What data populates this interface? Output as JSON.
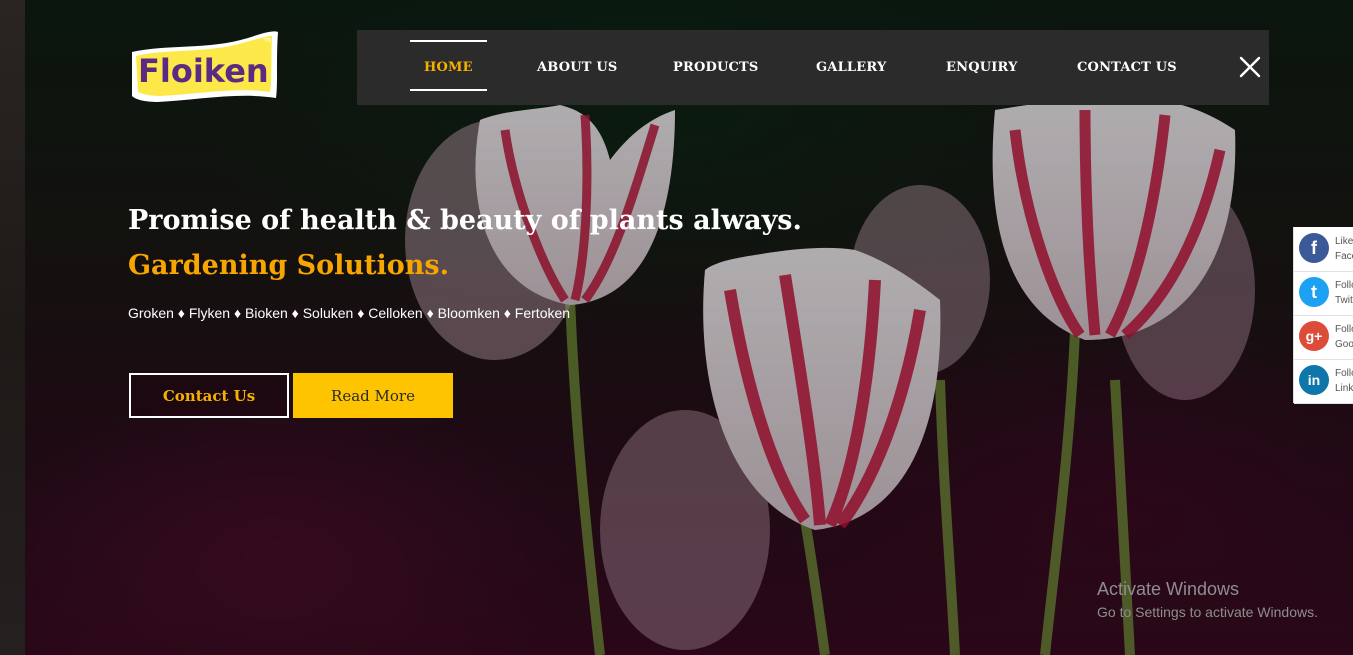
{
  "logo": {
    "text": "Floiken",
    "trademark": "TM"
  },
  "nav": {
    "items": [
      {
        "label": "HOME",
        "active": true
      },
      {
        "label": "ABOUT US",
        "active": false
      },
      {
        "label": "PRODUCTS",
        "active": false
      },
      {
        "label": "GALLERY",
        "active": false
      },
      {
        "label": "ENQUIRY",
        "active": false
      },
      {
        "label": "CONTACT US",
        "active": false
      }
    ],
    "close_icon": "close-icon"
  },
  "hero": {
    "headline": "Promise of health & beauty of plants always.",
    "subheadline": "Gardening Solutions.",
    "products_line": "Groken ♦ Flyken ♦ Bioken ♦ Soluken ♦ Celloken ♦ Bloomken ♦ Fertoken",
    "buttons": {
      "contact": "Contact Us",
      "read_more": "Read More"
    }
  },
  "social": [
    {
      "icon": "facebook-icon",
      "glyph": "f",
      "color": "#3b5998",
      "line1": "Like",
      "line2": "Facebook"
    },
    {
      "icon": "twitter-icon",
      "glyph": "t",
      "color": "#1da1f2",
      "line1": "Follow",
      "line2": "Twitter"
    },
    {
      "icon": "google-plus-icon",
      "glyph": "g+",
      "color": "#dd4b39",
      "line1": "Follow",
      "line2": "Google+"
    },
    {
      "icon": "linkedin-icon",
      "glyph": "in",
      "color": "#0e76a8",
      "line1": "Follow",
      "line2": "LinkedIn"
    }
  ],
  "watermark": {
    "line1": "Activate Windows",
    "line2": "Go to Settings to activate Windows."
  },
  "colors": {
    "accent_yellow": "#ffc400",
    "accent_orange": "#f7a600",
    "nav_bg": "#2b2b2b"
  }
}
